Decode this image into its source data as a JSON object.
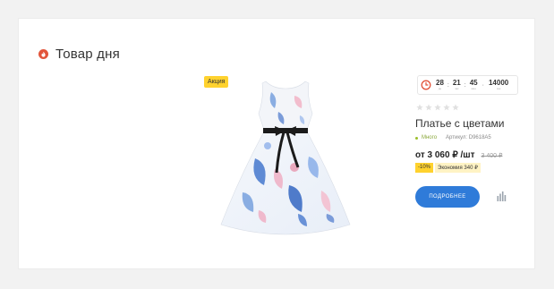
{
  "section": {
    "title": "Товар дня"
  },
  "badge": {
    "label": "Акция"
  },
  "countdown": {
    "days": "28",
    "days_label": "дн",
    "hours": "21",
    "hours_label": "час",
    "minutes": "45",
    "minutes_label": "мин",
    "seconds": "14000",
    "seconds_label": "сек"
  },
  "product": {
    "rating": 0,
    "rating_max": 5,
    "name": "Платье с цветами",
    "stock": "Много",
    "article": "Артикул: D9618A5",
    "price": "от 3 060 ₽ /шт",
    "old_price": "3 400 ₽",
    "discount": "-10%",
    "savings": "Экономия 340 ₽"
  },
  "actions": {
    "more_label": "ПОДРОБНЕЕ",
    "compare_icon": "compare-icon"
  },
  "colors": {
    "accent": "#2f7bd9",
    "badge": "#ffd22e",
    "fire": "#e2553b",
    "stock": "#9bbf2a"
  }
}
